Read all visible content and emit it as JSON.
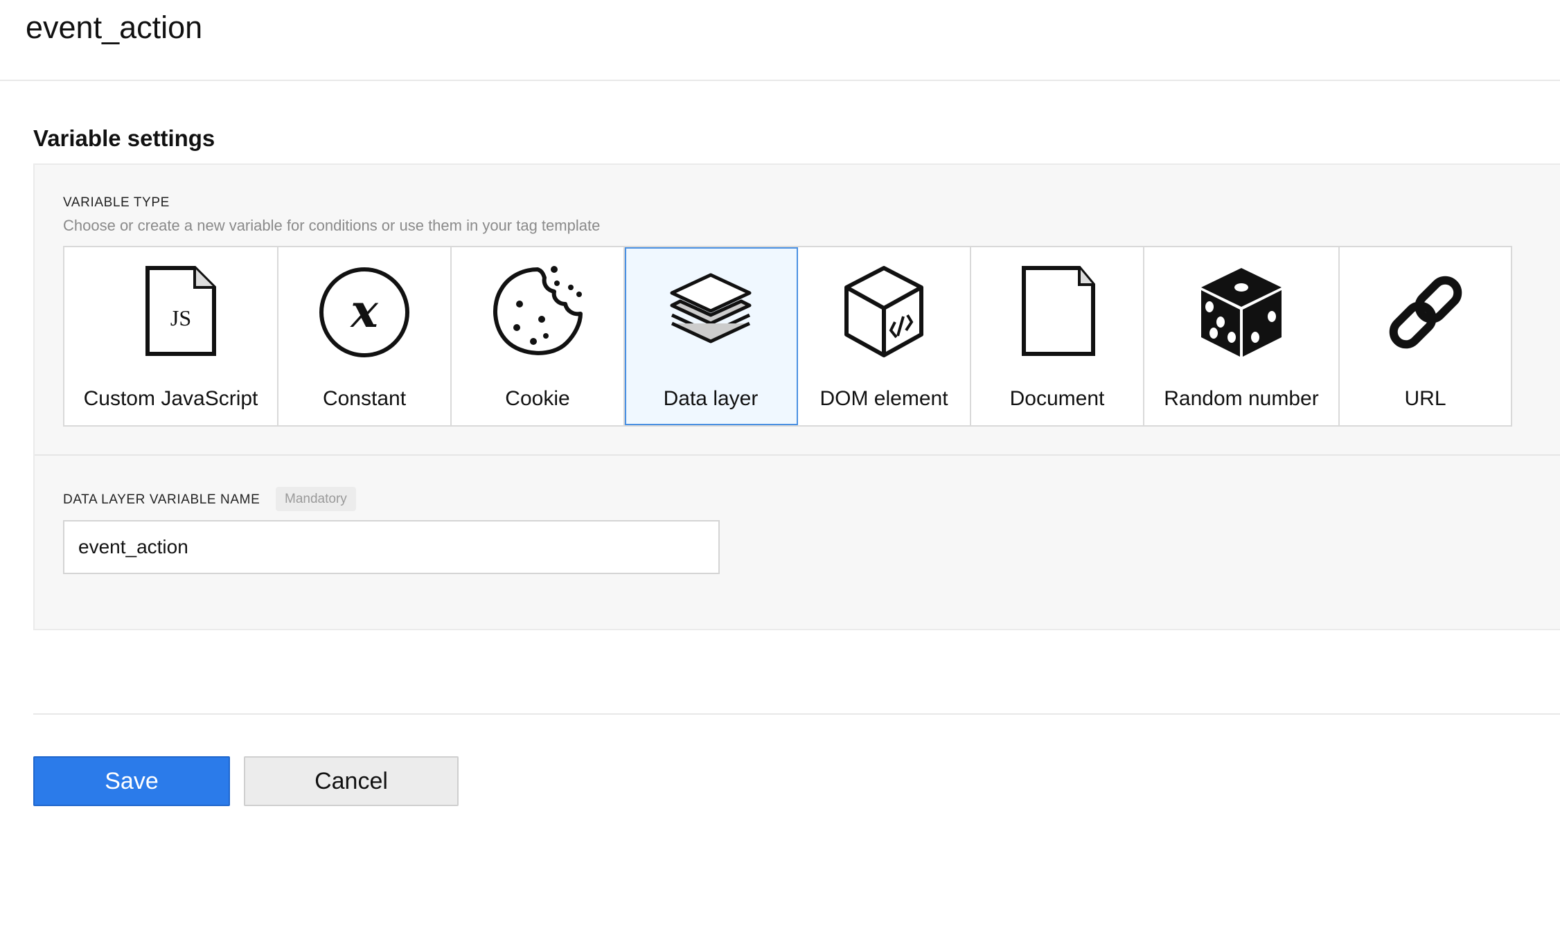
{
  "page": {
    "title": "event_action"
  },
  "settings": {
    "section_title": "Variable settings",
    "variable_type": {
      "label": "VARIABLE TYPE",
      "help": "Choose or create a new variable for conditions or use them in your tag template",
      "selected": "Data layer",
      "options": [
        {
          "label": "Custom JavaScript",
          "icon": "js-file-icon"
        },
        {
          "label": "Constant",
          "icon": "constant-x-icon"
        },
        {
          "label": "Cookie",
          "icon": "cookie-icon"
        },
        {
          "label": "Data layer",
          "icon": "layers-icon"
        },
        {
          "label": "DOM element",
          "icon": "dom-box-icon"
        },
        {
          "label": "Document",
          "icon": "document-icon"
        },
        {
          "label": "Random number",
          "icon": "dice-icon"
        },
        {
          "label": "URL",
          "icon": "link-icon"
        }
      ]
    },
    "data_layer": {
      "label": "DATA LAYER VARIABLE NAME",
      "badge": "Mandatory",
      "value": "event_action"
    }
  },
  "actions": {
    "save_label": "Save",
    "cancel_label": "Cancel"
  },
  "colors": {
    "primary": "#2b7bea",
    "selected_border": "#4a90e2",
    "selected_bg": "#f0f8ff",
    "panel_bg": "#f7f7f7"
  }
}
